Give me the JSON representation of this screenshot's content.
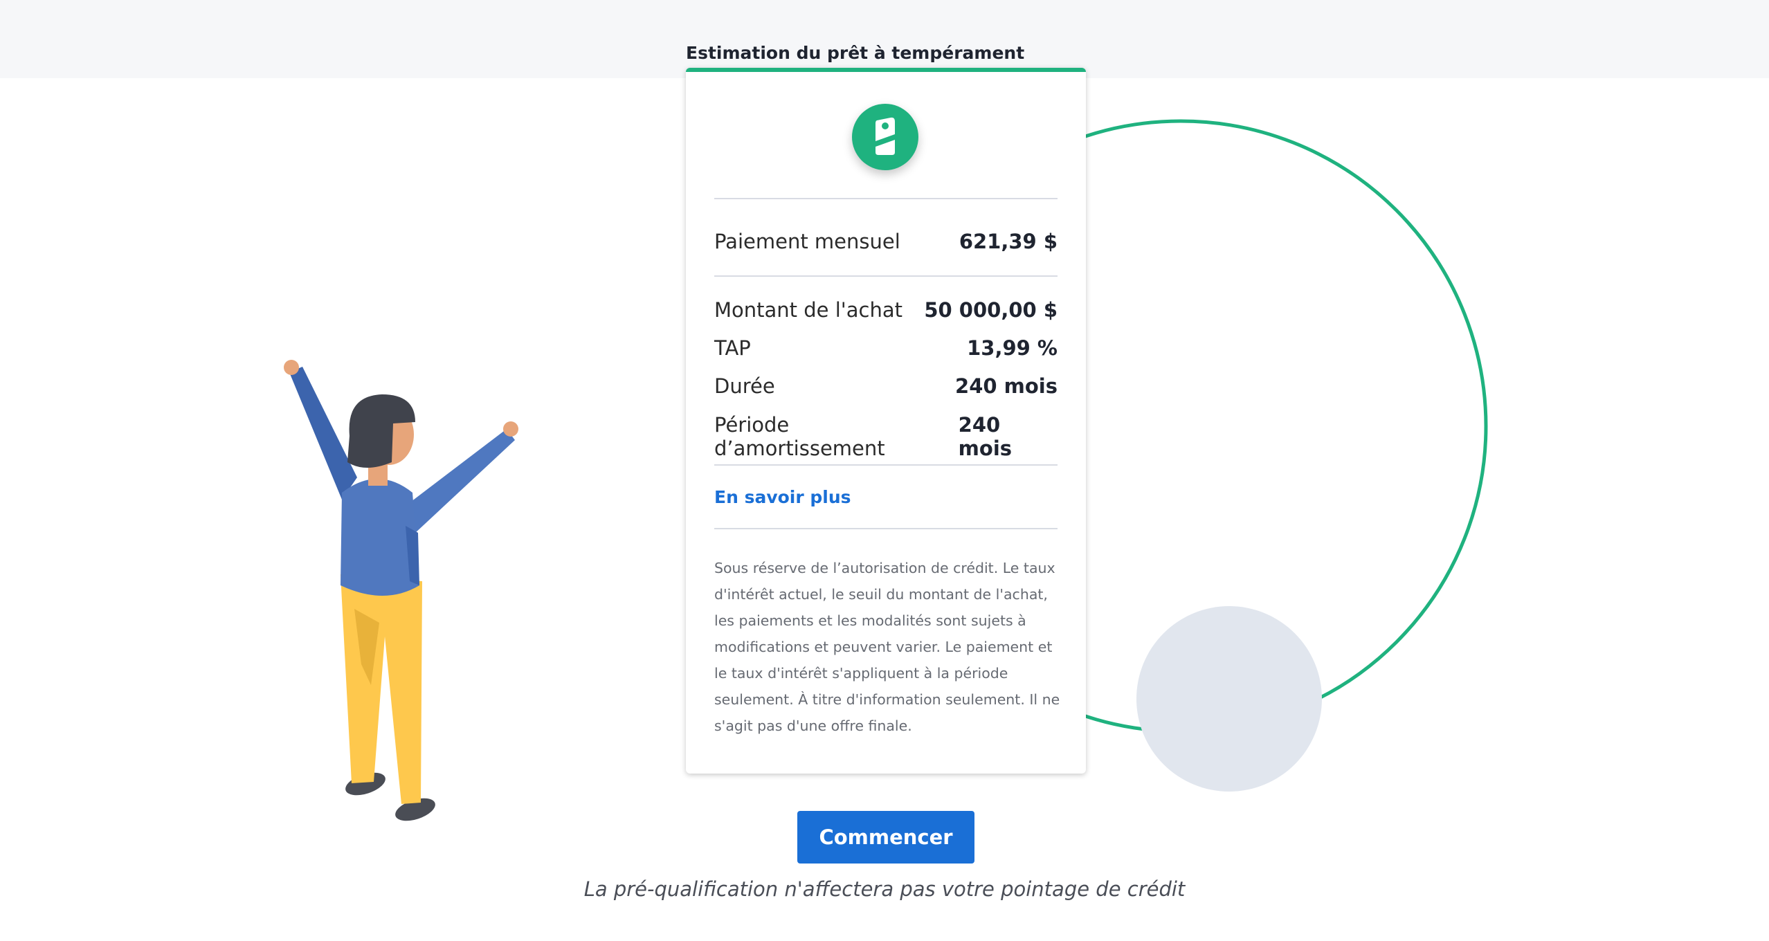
{
  "card": {
    "title": "Estimation du prêt à tempérament",
    "monthly": {
      "label": "Paiement mensuel",
      "value": "621,39 $"
    },
    "details": [
      {
        "label": "Montant de l'achat",
        "value": "50 000,00 $"
      },
      {
        "label": "TAP",
        "value": "13,99 %"
      },
      {
        "label": "Durée",
        "value": "240 mois"
      },
      {
        "label": "Période d’amortissement",
        "value": "240 mois"
      }
    ],
    "learn_more": "En savoir plus",
    "disclaimer": "Sous réserve de l’autorisation de crédit. Le taux d'intérêt actuel, le seuil du montant de l'achat, les paiements et les modalités sont sujets à modifications et peuvent varier. Le paiement et le taux d'intérêt s'appliquent à la période seulement. À titre d'information seulement. Il ne s'agit pas d'une offre finale.",
    "badge_icon": "price-tag-icon"
  },
  "cta": {
    "label": "Commencer"
  },
  "note": "La pré-qualification n'affectera pas votre pointage de crédit",
  "colors": {
    "accent": "#1fb27f",
    "primary": "#1a6fd6",
    "band": "#f6f7f9",
    "circle_fill": "#e1e6ee"
  }
}
